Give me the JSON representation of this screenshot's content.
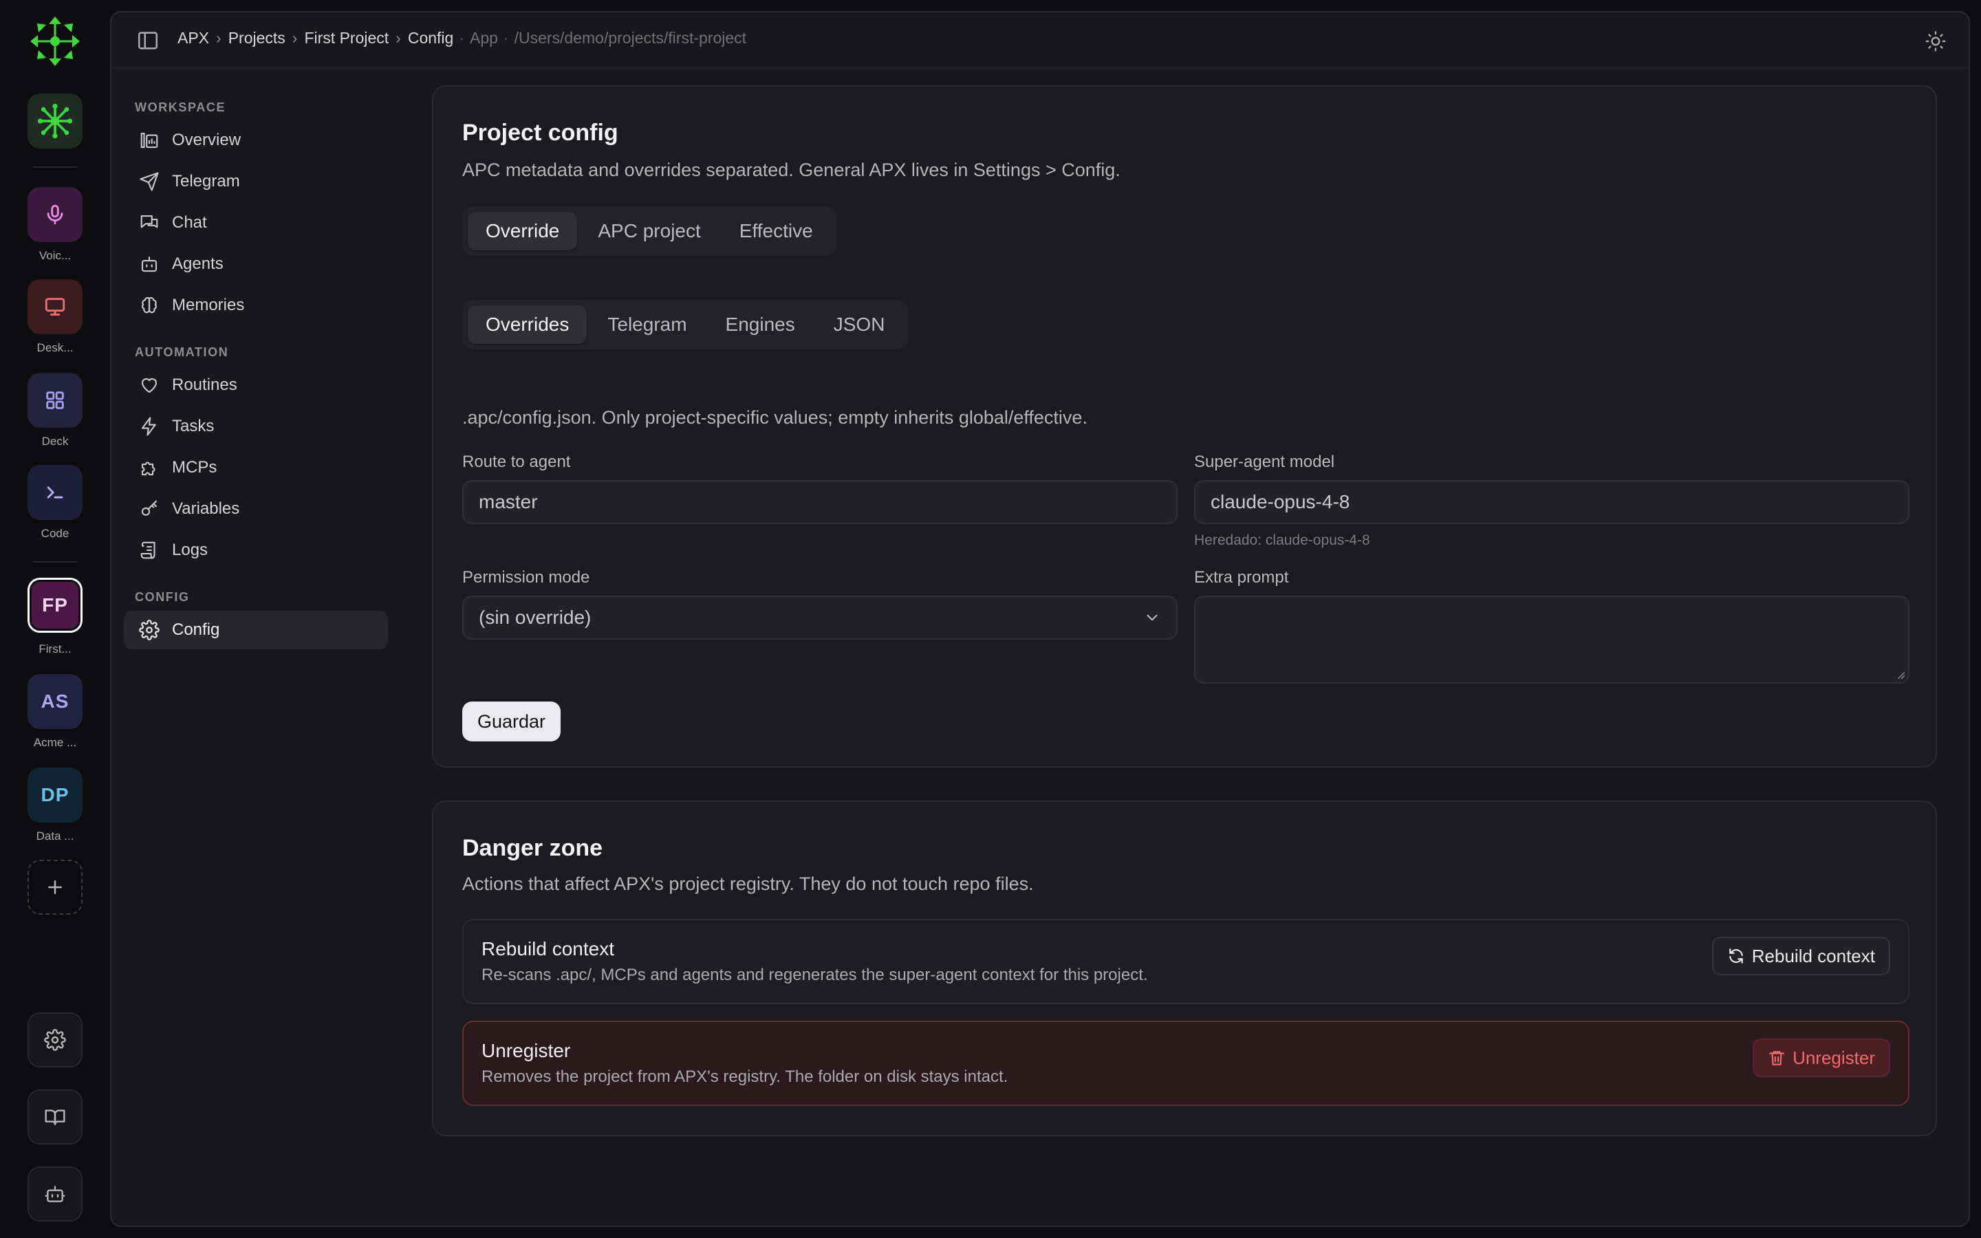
{
  "rail": {
    "apps": [
      {
        "name": "voice",
        "label": "Voic..."
      },
      {
        "name": "desktop",
        "label": "Desk..."
      },
      {
        "name": "deck",
        "label": "Deck"
      },
      {
        "name": "code",
        "label": "Code"
      }
    ],
    "projects": [
      {
        "initials": "FP",
        "label": "First...",
        "active": true,
        "color": "#4a1747"
      },
      {
        "initials": "AS",
        "label": "Acme ...",
        "active": false,
        "color": "#22213f"
      },
      {
        "initials": "DP",
        "label": "Data ...",
        "active": false,
        "color": "#112433"
      }
    ]
  },
  "breadcrumb": {
    "items": [
      "APX",
      "Projects",
      "First Project",
      "Config"
    ],
    "context": "App",
    "path": "/Users/demo/projects/first-project"
  },
  "sidebar": {
    "sections": [
      {
        "title": "WORKSPACE",
        "items": [
          "Overview",
          "Telegram",
          "Chat",
          "Agents",
          "Memories"
        ]
      },
      {
        "title": "AUTOMATION",
        "items": [
          "Routines",
          "Tasks",
          "MCPs",
          "Variables",
          "Logs"
        ]
      },
      {
        "title": "CONFIG",
        "items": [
          "Config"
        ]
      }
    ],
    "active_item": "Config"
  },
  "project_config": {
    "title": "Project config",
    "subtitle": "APC metadata and overrides separated. General APX lives in Settings > Config.",
    "tabs": [
      "Override",
      "APC project",
      "Effective"
    ],
    "active_tab": "Override",
    "subtabs": [
      "Overrides",
      "Telegram",
      "Engines",
      "JSON"
    ],
    "active_subtab": "Overrides",
    "description": ".apc/config.json. Only project-specific values; empty inherits global/effective.",
    "fields": {
      "route_label": "Route to agent",
      "route_value": "master",
      "model_label": "Super-agent model",
      "model_value": "claude-opus-4-8",
      "model_hint": "Heredado: claude-opus-4-8",
      "permission_label": "Permission mode",
      "permission_value": "(sin override)",
      "extra_label": "Extra prompt",
      "extra_value": ""
    },
    "save_label": "Guardar"
  },
  "danger_zone": {
    "title": "Danger zone",
    "subtitle": "Actions that affect APX's project registry. They do not touch repo files.",
    "rebuild": {
      "title": "Rebuild context",
      "description": "Re-scans .apc/, MCPs and agents and regenerates the super-agent context for this project.",
      "button": "Rebuild context"
    },
    "unregister": {
      "title": "Unregister",
      "description": "Removes the project from APX's registry. The folder on disk stays intact.",
      "button": "Unregister"
    }
  }
}
